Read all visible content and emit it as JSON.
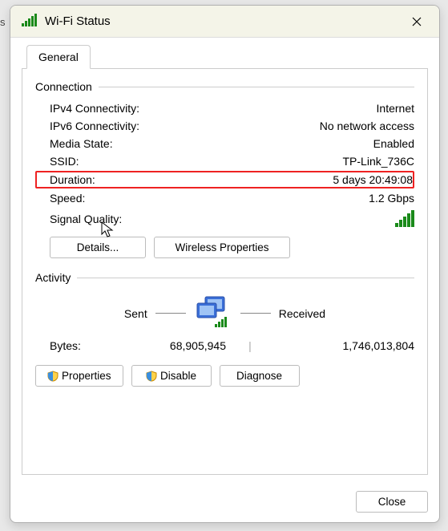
{
  "title": "Wi-Fi Status",
  "tabs": {
    "general": "General"
  },
  "groups": {
    "connection": {
      "label": "Connection",
      "ipv4_label": "IPv4 Connectivity:",
      "ipv4_value": "Internet",
      "ipv6_label": "IPv6 Connectivity:",
      "ipv6_value": "No network access",
      "media_label": "Media State:",
      "media_value": "Enabled",
      "ssid_label": "SSID:",
      "ssid_value": "TP-Link_736C",
      "duration_label": "Duration:",
      "duration_value": "5 days 20:49:08",
      "speed_label": "Speed:",
      "speed_value": "1.2 Gbps",
      "signal_label": "Signal Quality:"
    },
    "activity": {
      "label": "Activity",
      "sent_label": "Sent",
      "received_label": "Received",
      "bytes_label": "Bytes:",
      "sent_value": "68,905,945",
      "received_value": "1,746,013,804"
    }
  },
  "buttons": {
    "details": "Details...",
    "wireless": "Wireless Properties",
    "properties": "Properties",
    "disable": "Disable",
    "diagnose": "Diagnose",
    "close": "Close"
  },
  "edge_letter": "s"
}
